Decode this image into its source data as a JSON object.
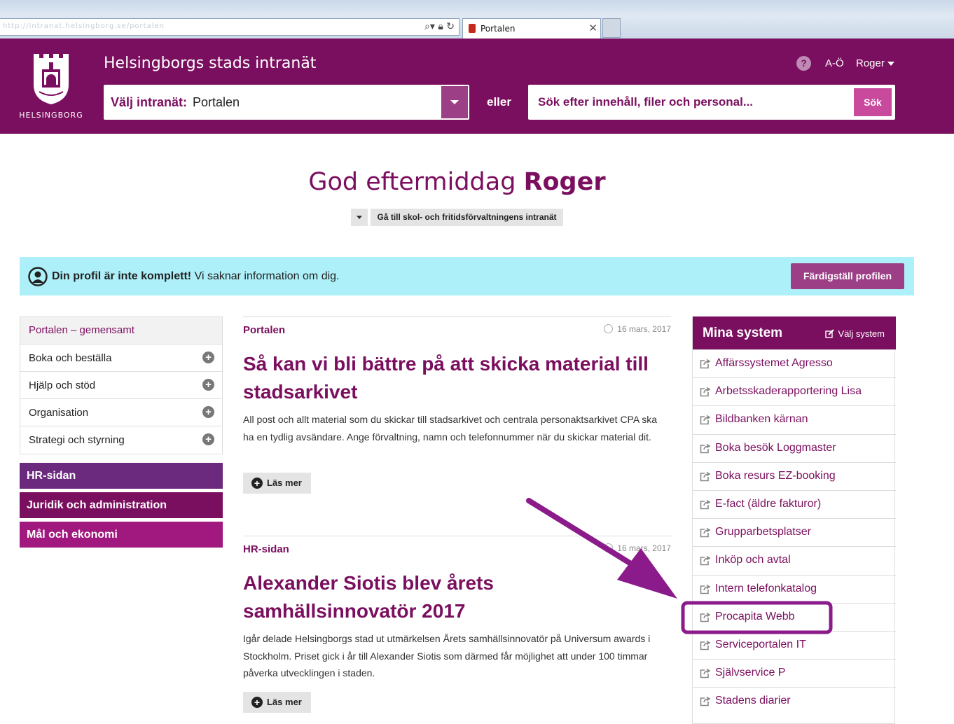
{
  "browser": {
    "address_ghost": "http://intranat.helsingborg.se/portalen",
    "tab_title": "Portalen",
    "tab_close": "✕"
  },
  "header": {
    "logo_text": "HELSINGBORG",
    "site_title": "Helsingborgs stads intranät",
    "help": "?",
    "az": "A-Ö",
    "user": "Roger",
    "select_label": "Välj intranät:",
    "select_value": "Portalen",
    "eller": "eller",
    "search_placeholder": "Sök efter innehåll, filer och personal...",
    "search_button": "Sök"
  },
  "greeting": {
    "prefix": "God eftermiddag ",
    "name": "Roger",
    "goto": "Gå till skol- och fritidsförvaltningens intranät"
  },
  "banner": {
    "bold": "Din profil är inte komplett!",
    "text": " Vi saknar information om dig.",
    "button": "Färdigställ profilen"
  },
  "leftnav": {
    "head": "Portalen – gemensamt",
    "items": [
      {
        "label": "Boka och beställa"
      },
      {
        "label": "Hjälp och stöd"
      },
      {
        "label": "Organisation"
      },
      {
        "label": "Strategi och styrning"
      }
    ],
    "buttons": [
      {
        "label": "HR-sidan",
        "color": "#6c2a7e"
      },
      {
        "label": "Juridik och administration",
        "color": "#7b0f5f"
      },
      {
        "label": "Mål och ekonomi",
        "color": "#a1187f"
      }
    ]
  },
  "articles": [
    {
      "source": "Portalen",
      "date": "16 mars, 2017",
      "title": "Så kan vi bli bättre på att skicka material till stadsarkivet",
      "body": "All post och allt material som du skickar till stadsarkivet och centrala personaktsarkivet CPA ska ha en tydlig avsändare. Ange förvaltning, namn och telefonnummer när du skickar material dit.",
      "more": "Läs mer"
    },
    {
      "source": "HR-sidan",
      "date": "16 mars, 2017",
      "title": "Alexander Siotis blev årets samhällsinnovatör 2017",
      "body": "Igår delade Helsingborgs stad ut utmärkelsen Årets samhällsinnovatör på Universum awards i Stockholm. Priset gick i år till Alexander Siotis som därmed får möjlighet att under 100 timmar påverka utvecklingen i staden.",
      "more": "Läs mer"
    }
  ],
  "systems": {
    "title": "Mina system",
    "choose": "Välj system",
    "items": [
      "Affärssystemet Agresso",
      "Arbetsskaderapportering Lisa",
      "Bildbanken kärnan",
      "Boka besök Loggmaster",
      "Boka resurs EZ-booking",
      "E-fact (äldre fakturor)",
      "Grupparbetsplatser",
      "Inköp och avtal",
      "Intern telefonkatalog",
      "Procapita Webb",
      "Serviceportalen IT",
      "Självservice P",
      "Stadens diarier"
    ],
    "highlighted": "Procapita Webb"
  },
  "colors": {
    "brand": "#7b0f5f",
    "accent": "#9c3f86",
    "banner": "#aef0f9",
    "annotation": "#8b1a8a"
  }
}
